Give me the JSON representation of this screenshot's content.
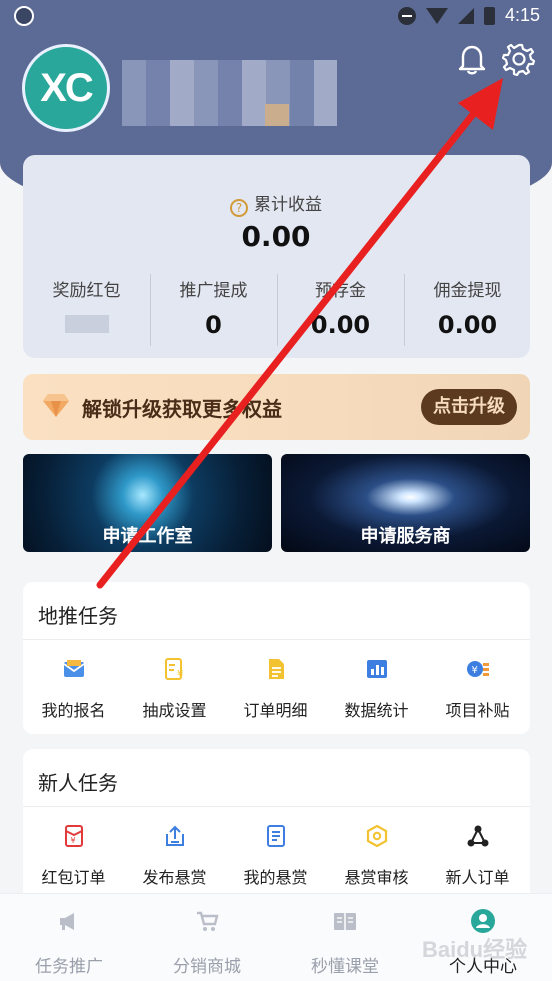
{
  "statusbar": {
    "time": "4:15"
  },
  "profile": {
    "avatar_text": "XC"
  },
  "earnings": {
    "total_label": "累计收益",
    "total_value": "0.00",
    "metrics": [
      {
        "label": "奖励红包",
        "value": ""
      },
      {
        "label": "推广提成",
        "value": "0"
      },
      {
        "label": "预存金",
        "value": "0.00"
      },
      {
        "label": "佣金提现",
        "value": "0.00"
      }
    ]
  },
  "upgrade": {
    "text": "解锁升级获取更多权益",
    "button": "点击升级"
  },
  "tiles": [
    {
      "label": "申请工作室"
    },
    {
      "label": "申请服务商"
    }
  ],
  "ground_tasks": {
    "title": "地推任务",
    "items": [
      {
        "label": "我的报名",
        "icon": "envelope-icon"
      },
      {
        "label": "抽成设置",
        "icon": "yen-list-icon"
      },
      {
        "label": "订单明细",
        "icon": "document-icon"
      },
      {
        "label": "数据统计",
        "icon": "bar-chart-icon"
      },
      {
        "label": "项目补贴",
        "icon": "coin-subsidy-icon"
      }
    ]
  },
  "new_tasks": {
    "title": "新人任务",
    "items": [
      {
        "label": "红包订单",
        "icon": "red-envelope-icon"
      },
      {
        "label": "发布悬赏",
        "icon": "upload-icon"
      },
      {
        "label": "我的悬赏",
        "icon": "list-document-icon"
      },
      {
        "label": "悬赏审核",
        "icon": "hexagon-icon"
      },
      {
        "label": "新人订单",
        "icon": "network-icon"
      }
    ]
  },
  "bottom_nav": [
    {
      "label": "任务推广",
      "icon": "megaphone-icon"
    },
    {
      "label": "分销商城",
      "icon": "cart-icon"
    },
    {
      "label": "秒懂课堂",
      "icon": "book-icon"
    },
    {
      "label": "个人中心",
      "icon": "user-icon"
    }
  ],
  "watermark": "Baidu经验",
  "colors": {
    "header": "#5c6b95",
    "accent_gold": "#d39b38",
    "upgrade_button": "#5c3a1f",
    "annotation_arrow": "#e82020"
  }
}
